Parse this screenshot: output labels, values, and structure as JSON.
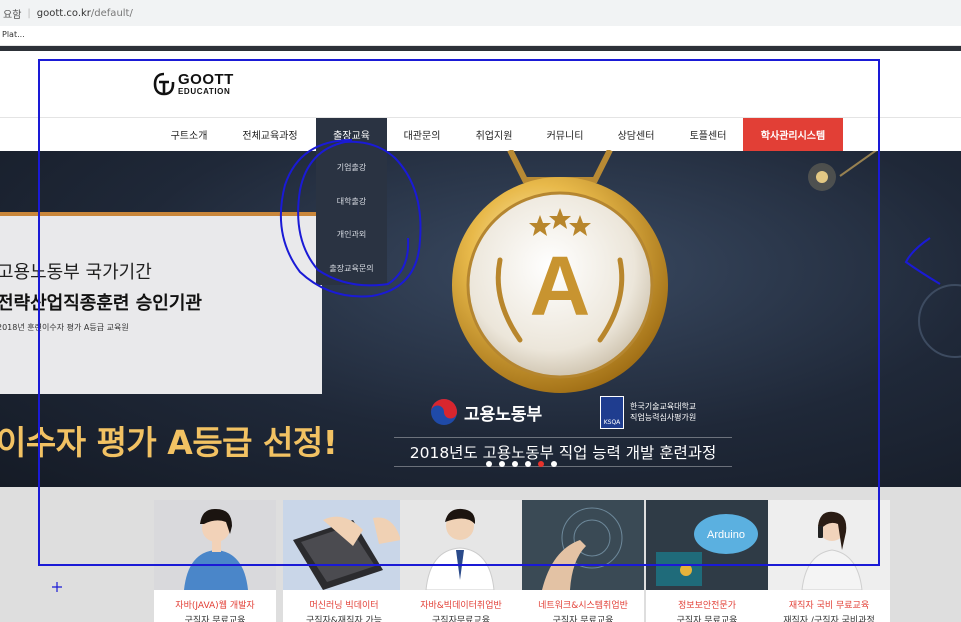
{
  "browser": {
    "security_label": "요함",
    "url_host": "goott.co.kr",
    "url_path": "/default/",
    "bookmark": "Plat..."
  },
  "logo": {
    "line1": "GOOTT",
    "line2": "EDUCATION"
  },
  "nav": {
    "items": [
      "구트소개",
      "전체교육과정",
      "출장교육",
      "대관문의",
      "취업지원",
      "커뮤니티",
      "상담센터",
      "토플센터"
    ],
    "hs_button": "학사관리시스템",
    "active_index": 2
  },
  "dropdown": {
    "items": [
      "기업출강",
      "대학출강",
      "개인과외",
      "출장교육문의"
    ]
  },
  "hero": {
    "line1": "고용노동부 국가기간",
    "line2": "전략산업직종훈련 승인기관",
    "line3": "2018년 훈련이수자 평가 A등급 교육원",
    "headline": "이수자 평가 A등급 선정!",
    "badge_letter": "A",
    "moel": "고용노동부",
    "ksqa_logo": "KSQA",
    "ksqa_line1": "한국기술교육대학교",
    "ksqa_line2": "직업능력심사평가원",
    "subhead": "2018년도 고용노동부 직업 능력 개발 훈련과정",
    "slides_count": 6,
    "active_slide": 4
  },
  "courses": [
    {
      "title": "자바(JAVA)웹 개발자",
      "sub": "구직자 무료교육"
    },
    {
      "title": "머신러닝 빅데이터",
      "sub": "구직자&재직자 가능"
    },
    {
      "title": "자바&빅데이터취업반",
      "sub": "구직자무료교육"
    },
    {
      "title": "네트워크&시스템취업반",
      "sub": "구직자 무료교육"
    },
    {
      "title": "정보보안전문가",
      "sub": "구직자 무료교육"
    },
    {
      "title": "재직자 국비 무료교육",
      "sub": "재직자 /구직자 국비과정"
    }
  ],
  "course_images": [
    "person-woman-icon",
    "laptop-hands-icon",
    "person-man-icon",
    "network-hand-icon",
    "arduino-board-icon",
    "phone-woman-icon"
  ],
  "arduino_label": "Arduino",
  "colors": {
    "accent": "#e23f36",
    "nav_active": "#2a3342",
    "annotation": "#1a1ad6",
    "gold": "#f2c263"
  }
}
